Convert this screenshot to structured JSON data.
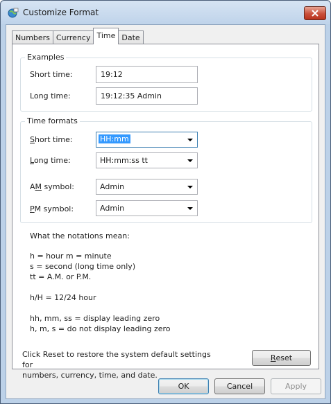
{
  "window": {
    "title": "Customize Format"
  },
  "tabs": [
    {
      "label": "Numbers"
    },
    {
      "label": "Currency"
    },
    {
      "label": "Time"
    },
    {
      "label": "Date"
    }
  ],
  "examples": {
    "group_label": "Examples",
    "short_label": "Short time:",
    "short_value": "19:12",
    "long_label": "Long time:",
    "long_value": "19:12:35 Admin"
  },
  "formats": {
    "group_label": "Time formats",
    "short": {
      "label_pre": "",
      "label_key": "S",
      "label_post": "hort time:",
      "value": "HH:mm"
    },
    "long": {
      "label_pre": "",
      "label_key": "L",
      "label_post": "ong time:",
      "value": "HH:mm:ss tt"
    },
    "am": {
      "label_pre": "A",
      "label_key": "M",
      "label_post": " symbol:",
      "value": "Admin"
    },
    "pm": {
      "label_pre": "",
      "label_key": "P",
      "label_post": "M symbol:",
      "value": "Admin"
    }
  },
  "notations": {
    "heading": "What the notations mean:",
    "line1": "h = hour   m = minute",
    "line2": "s = second (long time only)",
    "line3": "tt = A.M. or P.M.",
    "line4": "h/H = 12/24 hour",
    "line5": "hh, mm, ss = display leading zero",
    "line6": "h, m, s = do not display leading zero"
  },
  "footer": {
    "reset_text_1": "Click Reset to restore the system default settings for",
    "reset_text_2": "numbers, currency, time, and date.",
    "reset_key": "R",
    "reset_rest": "eset"
  },
  "buttons": {
    "ok": "OK",
    "cancel": "Cancel",
    "apply": "Apply"
  }
}
